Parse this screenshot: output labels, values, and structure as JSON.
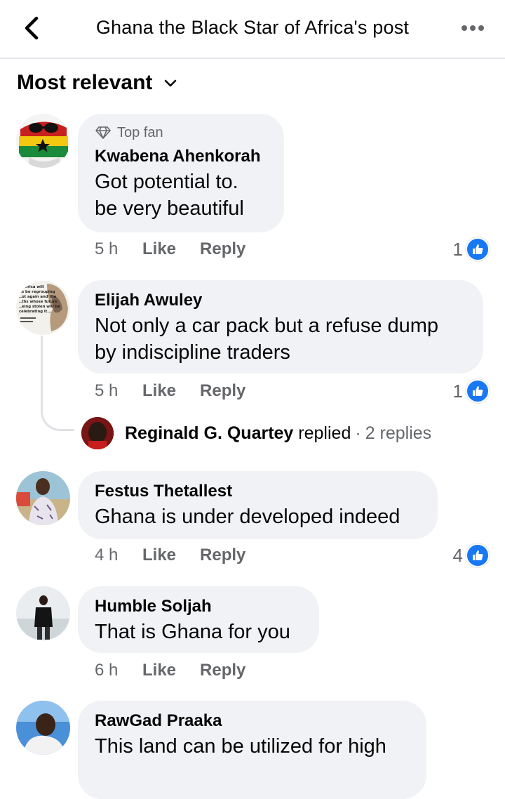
{
  "header": {
    "title": "Ghana the Black Star of Africa's post"
  },
  "sort": {
    "label": "Most relevant"
  },
  "comments": [
    {
      "badge": "Top fan",
      "author": "Kwabena Ahenkorah",
      "text_lines": [
        "Got potential to.",
        "be very beautiful"
      ],
      "time": "5 h",
      "like_label": "Like",
      "reply_label": "Reply",
      "reactions": "1"
    },
    {
      "author": "Elijah Awuley",
      "text_lines": [
        "Not only a car pack but a refuse dump",
        "by indiscipline traders"
      ],
      "time": "5 h",
      "like_label": "Like",
      "reply_label": "Reply",
      "reactions": "1",
      "avatar_text": [
        ".. Africa will",
        "..s be regrouping",
        "..ot again and the",
        "..ths whose future",
        "..eing stolen will be",
        "celebrating it..."
      ],
      "replies": {
        "name": "Reginald G. Quartey",
        "verb": "replied",
        "separator": "·",
        "count": "2 replies"
      }
    },
    {
      "author": "Festus Thetallest",
      "text_lines": [
        "Ghana is under developed indeed"
      ],
      "time": "4 h",
      "like_label": "Like",
      "reply_label": "Reply",
      "reactions": "4"
    },
    {
      "author": "Humble Soljah",
      "text_lines": [
        "That is Ghana for you"
      ],
      "time": "6 h",
      "like_label": "Like",
      "reply_label": "Reply"
    },
    {
      "author": "RawGad Praaka",
      "text_lines": [
        "This land can be utilized for high"
      ]
    }
  ],
  "colors": {
    "bubble_bg": "#f0f2f5",
    "meta_gray": "#65676b",
    "like_blue": "#1877f2"
  }
}
